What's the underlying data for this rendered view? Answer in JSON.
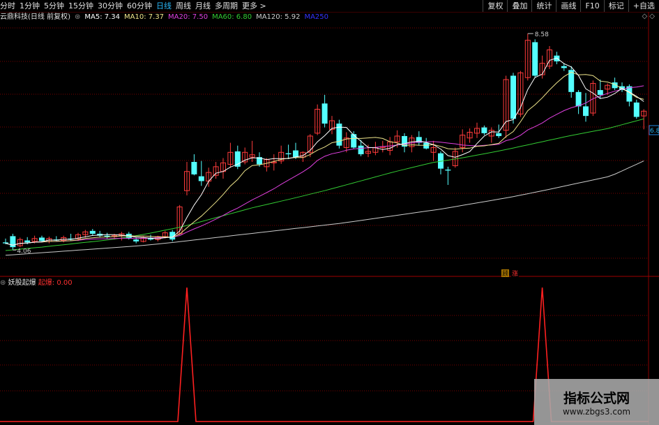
{
  "toolbar": {
    "periods": [
      "分时",
      "1分钟",
      "5分钟",
      "15分钟",
      "30分钟",
      "60分钟",
      "日线",
      "周线",
      "月线",
      "多周期",
      "更多 >"
    ],
    "active_period": "日线",
    "right_buttons": [
      "复权",
      "叠加",
      "统计",
      "画线",
      "F10",
      "标记",
      "+自选"
    ]
  },
  "ma_bar": {
    "title": "云鼎科技(日线 前复权)",
    "items": [
      {
        "label": "MA5: 7.34",
        "color": "#ffffff"
      },
      {
        "label": "MA10: 7.37",
        "color": "#f0e68c"
      },
      {
        "label": "MA20: 7.50",
        "color": "#e040e0"
      },
      {
        "label": "MA60: 6.80",
        "color": "#33cc33"
      },
      {
        "label": "MA120: 5.92",
        "color": "#cccccc"
      },
      {
        "label": "MA250",
        "color": "#3333ff"
      }
    ],
    "icons": "◇ ◇"
  },
  "annotations": {
    "high_label": "8.58",
    "low_label": "4.06",
    "price_tag": "6.8",
    "signal_left": "顾",
    "signal_right": "涨"
  },
  "indicator": {
    "name": "妖股起爆",
    "series_label": "起爆: 0.00"
  },
  "watermark": {
    "line1": "指标公式网",
    "line2": "www.zbgs3.com"
  },
  "colors": {
    "up": "#ff3b3b",
    "down": "#54ffff",
    "grid": "#7a0000",
    "ma5": "#ffffff",
    "ma10": "#f0e68c",
    "ma20": "#e040e0",
    "ma60": "#33cc33",
    "ma120": "#cccccc",
    "signal": "#ff2020"
  },
  "chart_data": {
    "type": "candlestick",
    "y_range": [
      3.7,
      8.8
    ],
    "candles": [
      {
        "o": 4.22,
        "h": 4.3,
        "l": 4.18,
        "c": 4.2
      },
      {
        "o": 4.35,
        "h": 4.4,
        "l": 4.06,
        "c": 4.12
      },
      {
        "o": 4.15,
        "h": 4.32,
        "l": 4.12,
        "c": 4.28
      },
      {
        "o": 4.26,
        "h": 4.33,
        "l": 4.18,
        "c": 4.22
      },
      {
        "o": 4.24,
        "h": 4.36,
        "l": 4.2,
        "c": 4.3
      },
      {
        "o": 4.32,
        "h": 4.36,
        "l": 4.22,
        "c": 4.25
      },
      {
        "o": 4.24,
        "h": 4.34,
        "l": 4.2,
        "c": 4.3
      },
      {
        "o": 4.28,
        "h": 4.35,
        "l": 4.25,
        "c": 4.26
      },
      {
        "o": 4.26,
        "h": 4.36,
        "l": 4.22,
        "c": 4.32
      },
      {
        "o": 4.3,
        "h": 4.4,
        "l": 4.25,
        "c": 4.28
      },
      {
        "o": 4.3,
        "h": 4.42,
        "l": 4.25,
        "c": 4.38
      },
      {
        "o": 4.38,
        "h": 4.48,
        "l": 4.32,
        "c": 4.44
      },
      {
        "o": 4.46,
        "h": 4.5,
        "l": 4.36,
        "c": 4.4
      },
      {
        "o": 4.4,
        "h": 4.46,
        "l": 4.32,
        "c": 4.36
      },
      {
        "o": 4.36,
        "h": 4.42,
        "l": 4.3,
        "c": 4.34
      },
      {
        "o": 4.34,
        "h": 4.4,
        "l": 4.28,
        "c": 4.36
      },
      {
        "o": 4.36,
        "h": 4.44,
        "l": 4.26,
        "c": 4.4
      },
      {
        "o": 4.4,
        "h": 4.44,
        "l": 4.28,
        "c": 4.3
      },
      {
        "o": 4.28,
        "h": 4.32,
        "l": 4.2,
        "c": 4.24
      },
      {
        "o": 4.24,
        "h": 4.34,
        "l": 4.22,
        "c": 4.32
      },
      {
        "o": 4.32,
        "h": 4.38,
        "l": 4.26,
        "c": 4.28
      },
      {
        "o": 4.28,
        "h": 4.36,
        "l": 4.24,
        "c": 4.34
      },
      {
        "o": 4.34,
        "h": 4.46,
        "l": 4.3,
        "c": 4.42
      },
      {
        "o": 4.44,
        "h": 4.48,
        "l": 4.24,
        "c": 4.28
      },
      {
        "o": 4.4,
        "h": 5.0,
        "l": 4.38,
        "c": 4.96
      },
      {
        "o": 5.3,
        "h": 5.9,
        "l": 5.2,
        "c": 5.7
      },
      {
        "o": 5.9,
        "h": 6.06,
        "l": 5.62,
        "c": 5.64
      },
      {
        "o": 5.6,
        "h": 5.92,
        "l": 5.4,
        "c": 5.5
      },
      {
        "o": 5.5,
        "h": 5.78,
        "l": 5.38,
        "c": 5.68
      },
      {
        "o": 5.62,
        "h": 5.9,
        "l": 5.55,
        "c": 5.8
      },
      {
        "o": 5.7,
        "h": 5.98,
        "l": 5.55,
        "c": 5.88
      },
      {
        "o": 5.85,
        "h": 6.3,
        "l": 5.78,
        "c": 6.1
      },
      {
        "o": 6.12,
        "h": 6.24,
        "l": 5.75,
        "c": 5.8
      },
      {
        "o": 5.9,
        "h": 6.2,
        "l": 5.85,
        "c": 6.1
      },
      {
        "o": 6.0,
        "h": 6.34,
        "l": 5.9,
        "c": 6.05
      },
      {
        "o": 6.0,
        "h": 6.1,
        "l": 5.8,
        "c": 5.85
      },
      {
        "o": 5.8,
        "h": 5.98,
        "l": 5.7,
        "c": 5.95
      },
      {
        "o": 5.88,
        "h": 6.06,
        "l": 5.72,
        "c": 5.9
      },
      {
        "o": 5.92,
        "h": 6.24,
        "l": 5.86,
        "c": 6.1
      },
      {
        "o": 6.08,
        "h": 6.26,
        "l": 5.96,
        "c": 6.06
      },
      {
        "o": 6.14,
        "h": 6.3,
        "l": 5.96,
        "c": 6.0
      },
      {
        "o": 6.0,
        "h": 6.12,
        "l": 5.9,
        "c": 6.1
      },
      {
        "o": 6.1,
        "h": 6.48,
        "l": 6.0,
        "c": 6.44
      },
      {
        "o": 6.5,
        "h": 7.1,
        "l": 6.46,
        "c": 7.0
      },
      {
        "o": 7.12,
        "h": 7.3,
        "l": 6.62,
        "c": 6.7
      },
      {
        "o": 6.58,
        "h": 6.86,
        "l": 6.48,
        "c": 6.76
      },
      {
        "o": 6.7,
        "h": 6.78,
        "l": 6.18,
        "c": 6.24
      },
      {
        "o": 6.2,
        "h": 6.52,
        "l": 6.1,
        "c": 6.4
      },
      {
        "o": 6.48,
        "h": 6.54,
        "l": 6.18,
        "c": 6.2
      },
      {
        "o": 6.24,
        "h": 6.36,
        "l": 6.02,
        "c": 6.06
      },
      {
        "o": 6.08,
        "h": 6.26,
        "l": 6.0,
        "c": 6.12
      },
      {
        "o": 6.1,
        "h": 6.32,
        "l": 6.04,
        "c": 6.2
      },
      {
        "o": 6.2,
        "h": 6.34,
        "l": 6.1,
        "c": 6.22
      },
      {
        "o": 6.14,
        "h": 6.42,
        "l": 6.04,
        "c": 6.32
      },
      {
        "o": 6.32,
        "h": 6.56,
        "l": 6.2,
        "c": 6.44
      },
      {
        "o": 6.44,
        "h": 6.5,
        "l": 6.1,
        "c": 6.22
      },
      {
        "o": 6.22,
        "h": 6.46,
        "l": 6.1,
        "c": 6.4
      },
      {
        "o": 6.42,
        "h": 6.54,
        "l": 6.24,
        "c": 6.3
      },
      {
        "o": 6.3,
        "h": 6.4,
        "l": 6.16,
        "c": 6.18
      },
      {
        "o": 6.1,
        "h": 6.34,
        "l": 5.92,
        "c": 6.2
      },
      {
        "o": 6.08,
        "h": 6.12,
        "l": 5.64,
        "c": 5.76
      },
      {
        "o": 5.74,
        "h": 5.8,
        "l": 5.42,
        "c": 5.72
      },
      {
        "o": 5.82,
        "h": 6.2,
        "l": 5.78,
        "c": 6.12
      },
      {
        "o": 6.2,
        "h": 6.58,
        "l": 6.1,
        "c": 6.46
      },
      {
        "o": 6.4,
        "h": 6.6,
        "l": 6.3,
        "c": 6.52
      },
      {
        "o": 6.5,
        "h": 6.72,
        "l": 6.4,
        "c": 6.6
      },
      {
        "o": 6.62,
        "h": 6.66,
        "l": 6.46,
        "c": 6.5
      },
      {
        "o": 6.44,
        "h": 6.62,
        "l": 6.3,
        "c": 6.56
      },
      {
        "o": 6.5,
        "h": 6.68,
        "l": 6.4,
        "c": 6.44
      },
      {
        "o": 6.56,
        "h": 7.7,
        "l": 6.4,
        "c": 7.62
      },
      {
        "o": 7.7,
        "h": 7.76,
        "l": 6.7,
        "c": 6.8
      },
      {
        "o": 6.9,
        "h": 7.8,
        "l": 6.84,
        "c": 7.76
      },
      {
        "o": 7.66,
        "h": 8.58,
        "l": 7.6,
        "c": 8.44
      },
      {
        "o": 8.4,
        "h": 8.46,
        "l": 7.66,
        "c": 7.7
      },
      {
        "o": 7.72,
        "h": 8.12,
        "l": 7.64,
        "c": 7.96
      },
      {
        "o": 7.9,
        "h": 8.32,
        "l": 7.84,
        "c": 8.24
      },
      {
        "o": 8.12,
        "h": 8.2,
        "l": 7.94,
        "c": 8.0
      },
      {
        "o": 7.9,
        "h": 7.96,
        "l": 7.8,
        "c": 7.86
      },
      {
        "o": 7.82,
        "h": 7.9,
        "l": 7.24,
        "c": 7.36
      },
      {
        "o": 7.36,
        "h": 7.4,
        "l": 6.9,
        "c": 7.06
      },
      {
        "o": 7.06,
        "h": 7.34,
        "l": 6.74,
        "c": 6.86
      },
      {
        "o": 6.92,
        "h": 7.6,
        "l": 6.86,
        "c": 7.54
      },
      {
        "o": 7.4,
        "h": 7.62,
        "l": 7.22,
        "c": 7.3
      },
      {
        "o": 7.42,
        "h": 7.54,
        "l": 7.3,
        "c": 7.5
      },
      {
        "o": 7.56,
        "h": 7.66,
        "l": 7.4,
        "c": 7.44
      },
      {
        "o": 7.48,
        "h": 7.56,
        "l": 7.36,
        "c": 7.4
      },
      {
        "o": 7.48,
        "h": 7.52,
        "l": 7.06,
        "c": 7.16
      },
      {
        "o": 7.14,
        "h": 7.2,
        "l": 6.8,
        "c": 6.84
      },
      {
        "o": 6.86,
        "h": 7.0,
        "l": 6.58,
        "c": 6.96
      }
    ],
    "ma60": [
      4.05,
      4.12,
      4.2,
      4.28,
      4.4,
      4.55,
      4.75,
      4.95,
      5.12,
      5.3,
      5.5,
      5.7,
      5.88,
      6.0,
      6.14,
      6.3,
      6.46,
      6.6,
      6.8
    ],
    "ma120": [
      3.95,
      4.0,
      4.05,
      4.1,
      4.15,
      4.22,
      4.3,
      4.38,
      4.46,
      4.54,
      4.62,
      4.72,
      4.82,
      4.92,
      5.04,
      5.16,
      5.3,
      5.45,
      5.6,
      5.92
    ],
    "signal_positions": [
      25,
      74
    ]
  }
}
